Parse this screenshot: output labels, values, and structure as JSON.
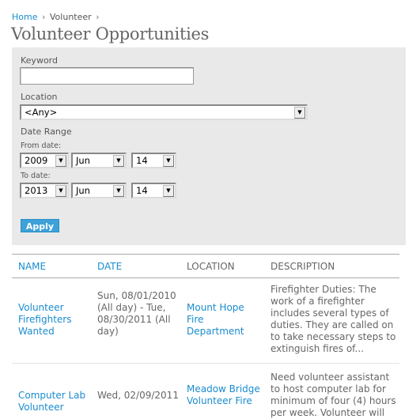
{
  "breadcrumb": {
    "items": [
      "Home",
      "Volunteer"
    ],
    "separator": "›"
  },
  "page_title": "Volunteer Opportunities",
  "filters": {
    "keyword": {
      "label": "Keyword",
      "value": ""
    },
    "location": {
      "label": "Location",
      "selected": "<Any>"
    },
    "date_range": {
      "label": "Date Range",
      "from": {
        "label": "From date:",
        "year": "2009",
        "month": "Jun",
        "day": "14"
      },
      "to": {
        "label": "To date:",
        "year": "2013",
        "month": "Jun",
        "day": "14"
      }
    },
    "apply_label": "Apply"
  },
  "table": {
    "columns": [
      "NAME",
      "DATE",
      "LOCATION",
      "DESCRIPTION"
    ],
    "rows": [
      {
        "name": "Volunteer Firefighters Wanted",
        "date": "Sun, 08/01/2010 (All day) - Tue, 08/30/2011 (All day)",
        "location": "Mount Hope Fire Department",
        "description": "Firefighter Duties: The work of a firefighter includes several types of duties. They are called on to take necessary steps to extinguish fires of..."
      },
      {
        "name": "Computer Lab Volunteer",
        "date": "Wed, 02/09/2011",
        "location": "Meadow Bridge Volunteer Fire",
        "description": "Need volunteer assistant to host computer lab for minimum of four (4) hours per week. Volunteer will"
      }
    ]
  },
  "colors": {
    "link": "#1a8ccf",
    "panel": "#e9e9e9",
    "button": "#3ea1d8"
  }
}
